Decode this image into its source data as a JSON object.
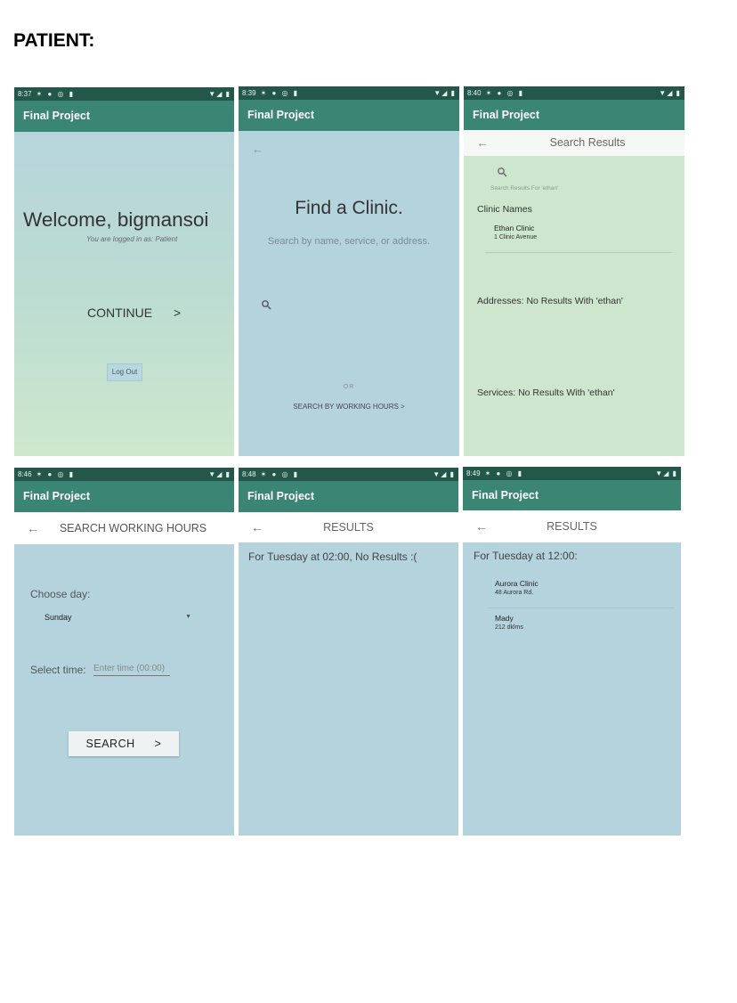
{
  "page": {
    "heading": "PATIENT:"
  },
  "common": {
    "app_title": "Final Project",
    "status_icons": "✶ ● ◎ ▮",
    "status_right": "▼◢ ▮"
  },
  "screens": {
    "welcome": {
      "time": "8:37",
      "greeting": "Welcome, bigmansoi",
      "logged_in": "You are logged in as: Patient",
      "continue_label": "CONTINUE",
      "continue_arrow": ">",
      "logout_label": "Log Out"
    },
    "find_clinic": {
      "time": "8:39",
      "back": "←",
      "title": "Find a Clinic.",
      "subtitle": "Search by name, service, or address.",
      "or_label": "OR",
      "hours_link": "SEARCH BY WORKING HOURS >"
    },
    "search_results": {
      "time": "8:40",
      "back": "←",
      "title": "Search Results",
      "query_caption": "Search Results For 'ethan'",
      "clinic_section": "Clinic Names",
      "clinics": [
        {
          "name": "Ethan Clinic",
          "address": "1 Clinic Avenue"
        }
      ],
      "addresses_msg": "Addresses: No Results With 'ethan'",
      "services_msg": "Services: No Results With 'ethan'"
    },
    "working_hours": {
      "time": "8:46",
      "back": "←",
      "title": "SEARCH WORKING HOURS",
      "choose_day_label": "Choose day:",
      "day_value": "Sunday",
      "select_time_label": "Select time:",
      "time_placeholder": "Enter time (00:00)",
      "search_label": "SEARCH",
      "search_arrow": ">"
    },
    "results_none": {
      "time": "8:48",
      "back": "←",
      "title": "RESULTS",
      "message": "For Tuesday at 02:00, No Results :("
    },
    "results_found": {
      "time": "8:49",
      "back": "←",
      "title": "RESULTS",
      "message": "For Tuesday at 12:00:",
      "clinics": [
        {
          "name": "Aurora Clinic",
          "address": "48 Aurora Rd."
        },
        {
          "name": "Mady",
          "address": "212 dklms"
        }
      ]
    }
  }
}
